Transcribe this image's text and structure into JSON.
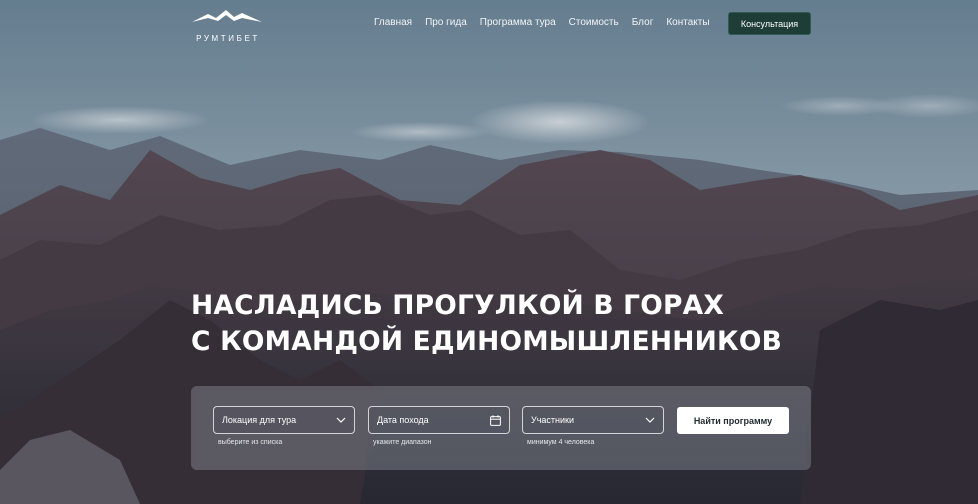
{
  "brand": {
    "name": "РУМТИБЕТ"
  },
  "nav": {
    "items": [
      {
        "label": "Главная"
      },
      {
        "label": "Про гида"
      },
      {
        "label": "Программа тура"
      },
      {
        "label": "Стоимость"
      },
      {
        "label": "Блог"
      },
      {
        "label": "Контакты"
      }
    ],
    "cta_label": "Консультация"
  },
  "hero": {
    "title_line1": "Насладись прогулкой в горах",
    "title_line2": "с командой единомышленников"
  },
  "search": {
    "location": {
      "value": "Локация для тура",
      "hint": "выберите из списка",
      "icon": "chevron-down-icon"
    },
    "date": {
      "value": "Дата похода",
      "hint": "укажите диапазон",
      "icon": "calendar-icon"
    },
    "participants": {
      "value": "Участники",
      "hint": "минимум 4 человека",
      "icon": "chevron-down-icon"
    },
    "submit_label": "Найти программу"
  },
  "colors": {
    "accent": "#1d3d36",
    "sky": "#7f97a7",
    "mountain": "#5a4a4f"
  }
}
